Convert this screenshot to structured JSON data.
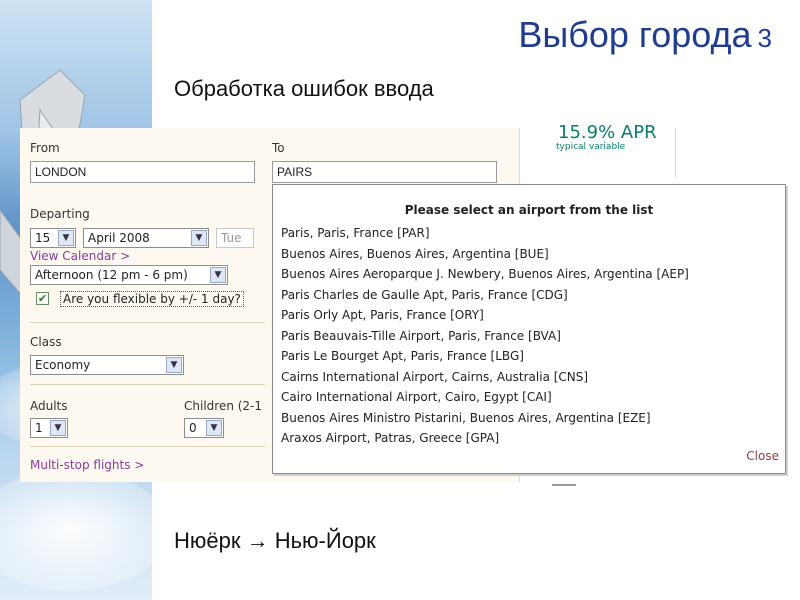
{
  "slide": {
    "title": "Выбор города",
    "title_number": "3",
    "subtitle": "Обработка ошибок ввода",
    "footer": "Нюёрк → Нью-Йорк"
  },
  "form": {
    "from_label": "From",
    "from_value": "LONDON",
    "to_label": "To",
    "to_value": "PAIRS",
    "departing_label": "Departing",
    "day_value": "15",
    "month_value": "April 2008",
    "weekday_value": "Tue",
    "view_calendar": "View Calendar >",
    "time_value": "Afternoon (12 pm - 6 pm)",
    "flexible_label": "Are you flexible by +/- 1 day?",
    "flexible_checked": true,
    "class_label": "Class",
    "class_value": "Economy",
    "adults_label": "Adults",
    "adults_value": "1",
    "children_label": "Children (2-1",
    "children_value": "0",
    "multistop": "Multi-stop flights >"
  },
  "ad": {
    "rate": "15.9% APR",
    "note": "typical variable"
  },
  "popup": {
    "heading": "Please select an airport from the list",
    "airports": [
      "Paris, Paris, France [PAR]",
      "Buenos Aires, Buenos Aires, Argentina [BUE]",
      "Buenos Aires Aeroparque J. Newbery, Buenos Aires, Argentina [AEP]",
      "Paris Charles de Gaulle Apt, Paris, France [CDG]",
      "Paris Orly Apt, Paris, France [ORY]",
      "Paris Beauvais-Tille Airport, Paris, France [BVA]",
      "Paris Le Bourget Apt, Paris, France [LBG]",
      "Cairns International Airport, Cairns, Australia [CNS]",
      "Cairo International Airport, Cairo, Egypt [CAI]",
      "Buenos Aires Ministro Pistarini, Buenos Aires, Argentina [EZE]",
      "Araxos Airport, Patras, Greece [GPA]"
    ],
    "close_label": "Close"
  },
  "colors": {
    "title": "#1f3c8f",
    "link": "#8a3b9a",
    "panel_bg": "#fdf9f0",
    "ad_text": "#0a7d6a"
  },
  "icons": {
    "dropdown": "dropdown-arrow-icon",
    "checkbox": "checkmark-icon",
    "decoration": "airplane-icon"
  }
}
